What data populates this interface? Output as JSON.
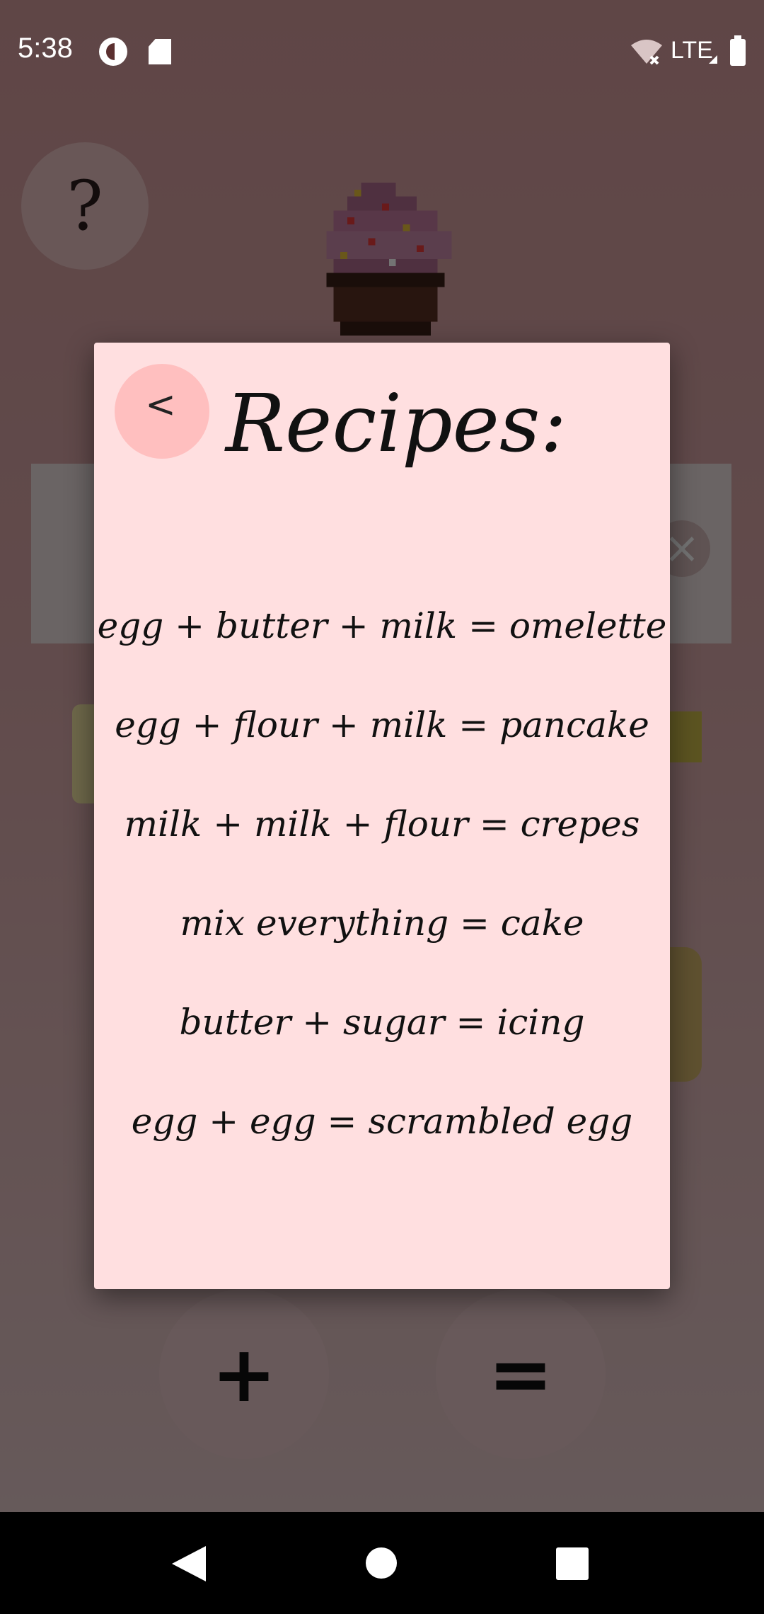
{
  "status_bar": {
    "time": "5:38",
    "network": "LTE"
  },
  "background_app": {
    "help_label": "?",
    "plus_label": "+",
    "equals_label": "="
  },
  "dialog": {
    "back_label": "<",
    "title": "Recipes:",
    "recipes": [
      "egg + butter + milk = omelette",
      "egg + flour + milk = pancake",
      "milk + milk + flour = crepes",
      "mix everything = cake",
      "butter + sugar = icing",
      "egg + egg = scrambled egg"
    ]
  },
  "colors": {
    "dialog_background": "#ffdfe0",
    "back_button": "#ffbfbf",
    "app_background": "#d39b9c"
  },
  "icons": {
    "status": [
      "data-saver-icon",
      "sd-card-icon",
      "wifi-off-icon",
      "signal-icon",
      "battery-icon"
    ],
    "navigation": [
      "nav-back-icon",
      "nav-home-icon",
      "nav-recents-icon"
    ]
  }
}
